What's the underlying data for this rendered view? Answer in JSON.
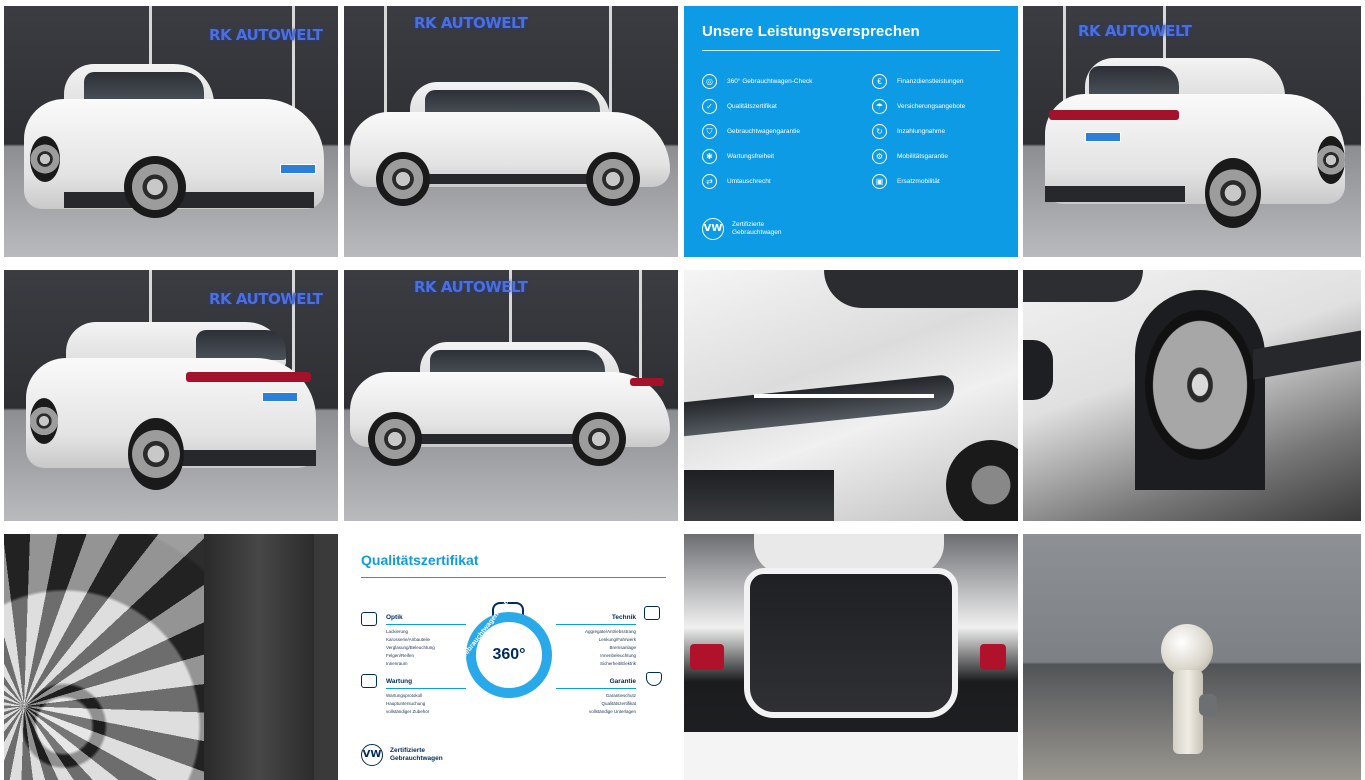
{
  "gallery": {
    "showroom_sign": "RK AUTOWELT",
    "promo": {
      "title": "Unsere Leistungsversprechen",
      "left_items": [
        "360° Gebrauchtwagen-Check",
        "Qualitätszertifikat",
        "Gebrauchtwagengarantie",
        "Wartungsfreiheit",
        "Umtauschrecht"
      ],
      "right_items": [
        "Finanzdienstleistungen",
        "Versicherungsangebote",
        "Inzahlungnahme",
        "Mobilitätsgarantie",
        "Ersatzmobilität"
      ],
      "footer_line1": "Zertifizierte",
      "footer_line2": "Gebrauchtwagen"
    },
    "certificate": {
      "title": "Qualitätszertifikat",
      "center_value": "360°",
      "ring_text": "Gebrauchtwagen-Check",
      "optik": {
        "heading": "Optik",
        "items": [
          "Lackierung",
          "Karosserie/Anbauteile",
          "Verglasung/Beleuchtung",
          "Felgen/Reifen",
          "Innenraum"
        ]
      },
      "technik": {
        "heading": "Technik",
        "items": [
          "Aggregate/Antriebsstrang",
          "Lenkung/Fahrwerk",
          "Bremsanlage",
          "Innenbeleuchtung",
          "Sicherheit/Elektrik"
        ]
      },
      "wartung": {
        "heading": "Wartung",
        "items": [
          "Wartungsprotokoll",
          "Hauptuntersuchung",
          "vollständiger Zubehör"
        ]
      },
      "garantie": {
        "heading": "Garantie",
        "items": [
          "Garantieschutz",
          "Qualitätszertifikat",
          "vollständige Unterlagen"
        ]
      },
      "footer_line1": "Zertifizierte",
      "footer_line2": "Gebrauchtwagen"
    },
    "vw_logo": "VW"
  }
}
